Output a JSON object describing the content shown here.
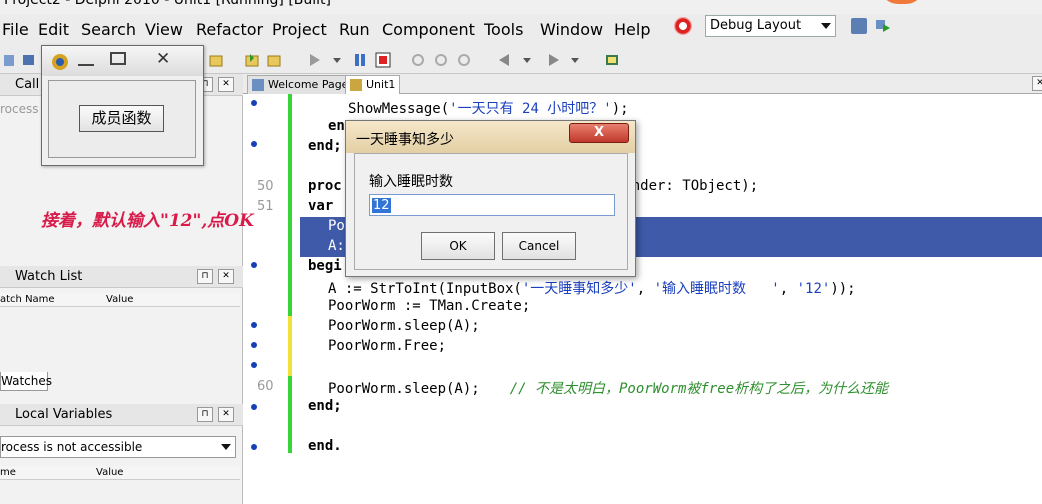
{
  "window": {
    "title": "Project2 - Delphi 2010 - Unit1 [Running] [Built]"
  },
  "menu": [
    "File",
    "Edit",
    "Search",
    "View",
    "Refactor",
    "Project",
    "Run",
    "Component",
    "Tools",
    "Window",
    "Help"
  ],
  "layout_combo": {
    "value": "Debug Layout"
  },
  "panes": {
    "call_stack": {
      "title": "Call",
      "status": "rocess i"
    },
    "watch_list": {
      "title": "Watch List",
      "col_name": "atch Name",
      "col_value": "Value",
      "tab": "Watches"
    },
    "local_vars": {
      "title": "Local Variables",
      "combo": "rocess is not accessible",
      "col_name": "me",
      "col_value": "Value"
    }
  },
  "editor": {
    "tabs": [
      "Welcome Page",
      "Unit1"
    ],
    "line_numbers": [
      "50",
      "51",
      "60"
    ]
  },
  "code": {
    "l1a": "ShowMessage(",
    "l1b": "'一天只有 24 小时吧？'",
    "l1c": ");",
    "l2": "en",
    "l3": "end;",
    "l4a": "proc",
    "l4b": "nder: TObject);",
    "l5": "var",
    "l6": "Po",
    "l7": "A:",
    "l8": "begi",
    "l9a": "A := StrToInt(InputBox(",
    "l9b": "'一天睡事知多少'",
    "l9c": ", ",
    "l9d": "'输入睡眠时数   '",
    "l9e": ", ",
    "l9f": "'12'",
    "l9g": "));",
    "l10": "PoorWorm := TMan.Create;",
    "l11": "PoorWorm.sleep(A);",
    "l12": "PoorWorm.Free;",
    "l13a": "PoorWorm.sleep(A);",
    "l13b": "// 不是太明白，PoorWorm被free析构了之后，为什么还能",
    "l14": "end;",
    "l15": "end."
  },
  "small_form": {
    "button_label": "成员函数"
  },
  "dialog": {
    "title": "一天睡事知多少",
    "close_label": "X",
    "prompt": "输入睡眠时数",
    "input_value": "12",
    "ok_label": "OK",
    "cancel_label": "Cancel"
  },
  "annotation": "接着，默认输入\"12\",点OK",
  "colors": {
    "accent_blue": "#1640b8",
    "annotation_red": "#d81b4a",
    "comment_green": "#2f8f2f",
    "string_blue": "#1a3fbf",
    "selection": "#3e5aa8"
  }
}
